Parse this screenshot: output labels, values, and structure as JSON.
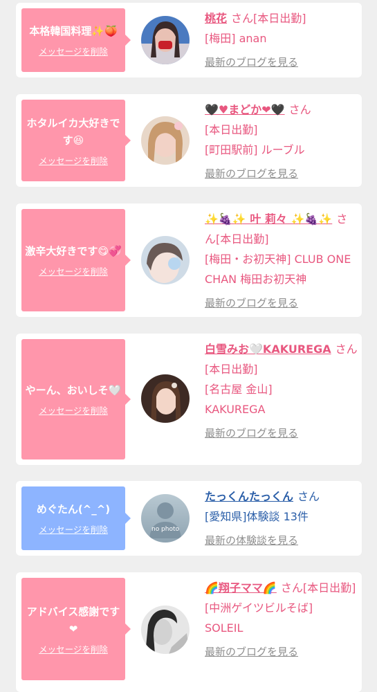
{
  "colors": {
    "pink_bubble": "#ff96ab",
    "blue_bubble": "#8db4ff",
    "pink_text": "#e8577f",
    "blue_text": "#2a5ea8",
    "link_gray": "#8e8e8e"
  },
  "delete_label": "メッセージを削除",
  "blog_link": "最新のブログを見る",
  "report_link": "最新の体験談を見る",
  "cards": [
    {
      "message": "本格韓国料理✨🍑",
      "name": "桃花",
      "san": "さん[本日出勤]",
      "lines": [
        "[梅田] anan"
      ]
    },
    {
      "message": "ホタルイカ大好きです😆",
      "name": "🖤♥まどか❤🖤",
      "san": "さん",
      "lines": [
        "[本日出勤]",
        "[町田駅前] ルーブル"
      ]
    },
    {
      "message": "激辛大好きです😋💞",
      "name": "✨🍇✨ 叶 莉々 ✨🍇✨",
      "san": "さん[本日出勤]",
      "lines": [
        "[梅田・お初天神] CLUB ONE CHAN 梅田お初天神"
      ]
    },
    {
      "message": "やーん、おいしそ🤍",
      "name": "白雪みお🤍KAKUREGA",
      "san": "さん[本日出勤]",
      "lines": [
        "[名古屋 金山] KAKUREGA"
      ]
    },
    {
      "message": "めぐたん(^_^)",
      "name": "たっくんたっくん",
      "san": "さん",
      "lines": [
        "[愛知県]体験談 13件"
      ],
      "avatar_text": "no photo"
    },
    {
      "message": "アドバイス感謝です❤",
      "name": "🌈翔子ママ🌈",
      "san": "さん[本日出勤]",
      "lines": [
        "[中洲ゲイツビルそば] SOLEIL"
      ]
    }
  ]
}
